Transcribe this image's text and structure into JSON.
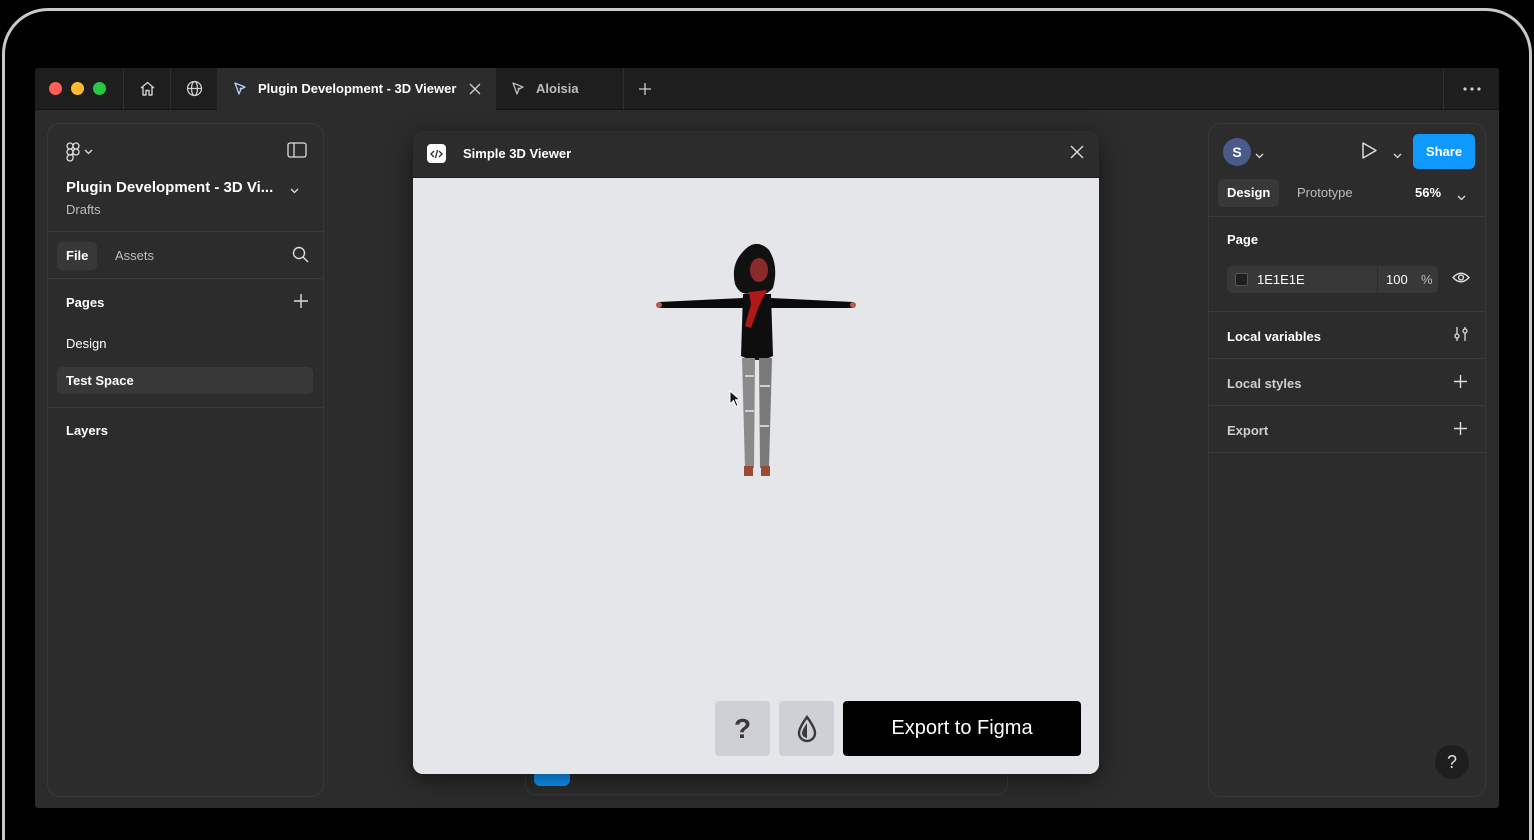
{
  "titlebar": {
    "tabs": [
      {
        "label": "Plugin Development - 3D Viewer",
        "active": true
      },
      {
        "label": "Aloisia",
        "active": false
      }
    ]
  },
  "left_panel": {
    "file_title": "Plugin Development - 3D Vi...",
    "location": "Drafts",
    "tabs": {
      "file": "File",
      "assets": "Assets"
    },
    "pages_heading": "Pages",
    "pages": [
      {
        "name": "Design",
        "selected": false
      },
      {
        "name": "Test Space",
        "selected": true
      }
    ],
    "layers_heading": "Layers"
  },
  "plugin": {
    "title": "Simple 3D Viewer",
    "help_label": "?",
    "export_label": "Export to Figma"
  },
  "right_panel": {
    "avatar_initial": "S",
    "share_label": "Share",
    "tabs": {
      "design": "Design",
      "prototype": "Prototype"
    },
    "zoom": "56%",
    "page_heading": "Page",
    "background": {
      "hex": "1E1E1E",
      "opacity": "100",
      "unit": "%"
    },
    "local_variables": "Local variables",
    "local_styles": "Local styles",
    "export": "Export",
    "help": "?"
  },
  "colors": {
    "accent": "#0d99ff",
    "panel": "#2c2c2c",
    "canvas": "#e5e6ea"
  }
}
